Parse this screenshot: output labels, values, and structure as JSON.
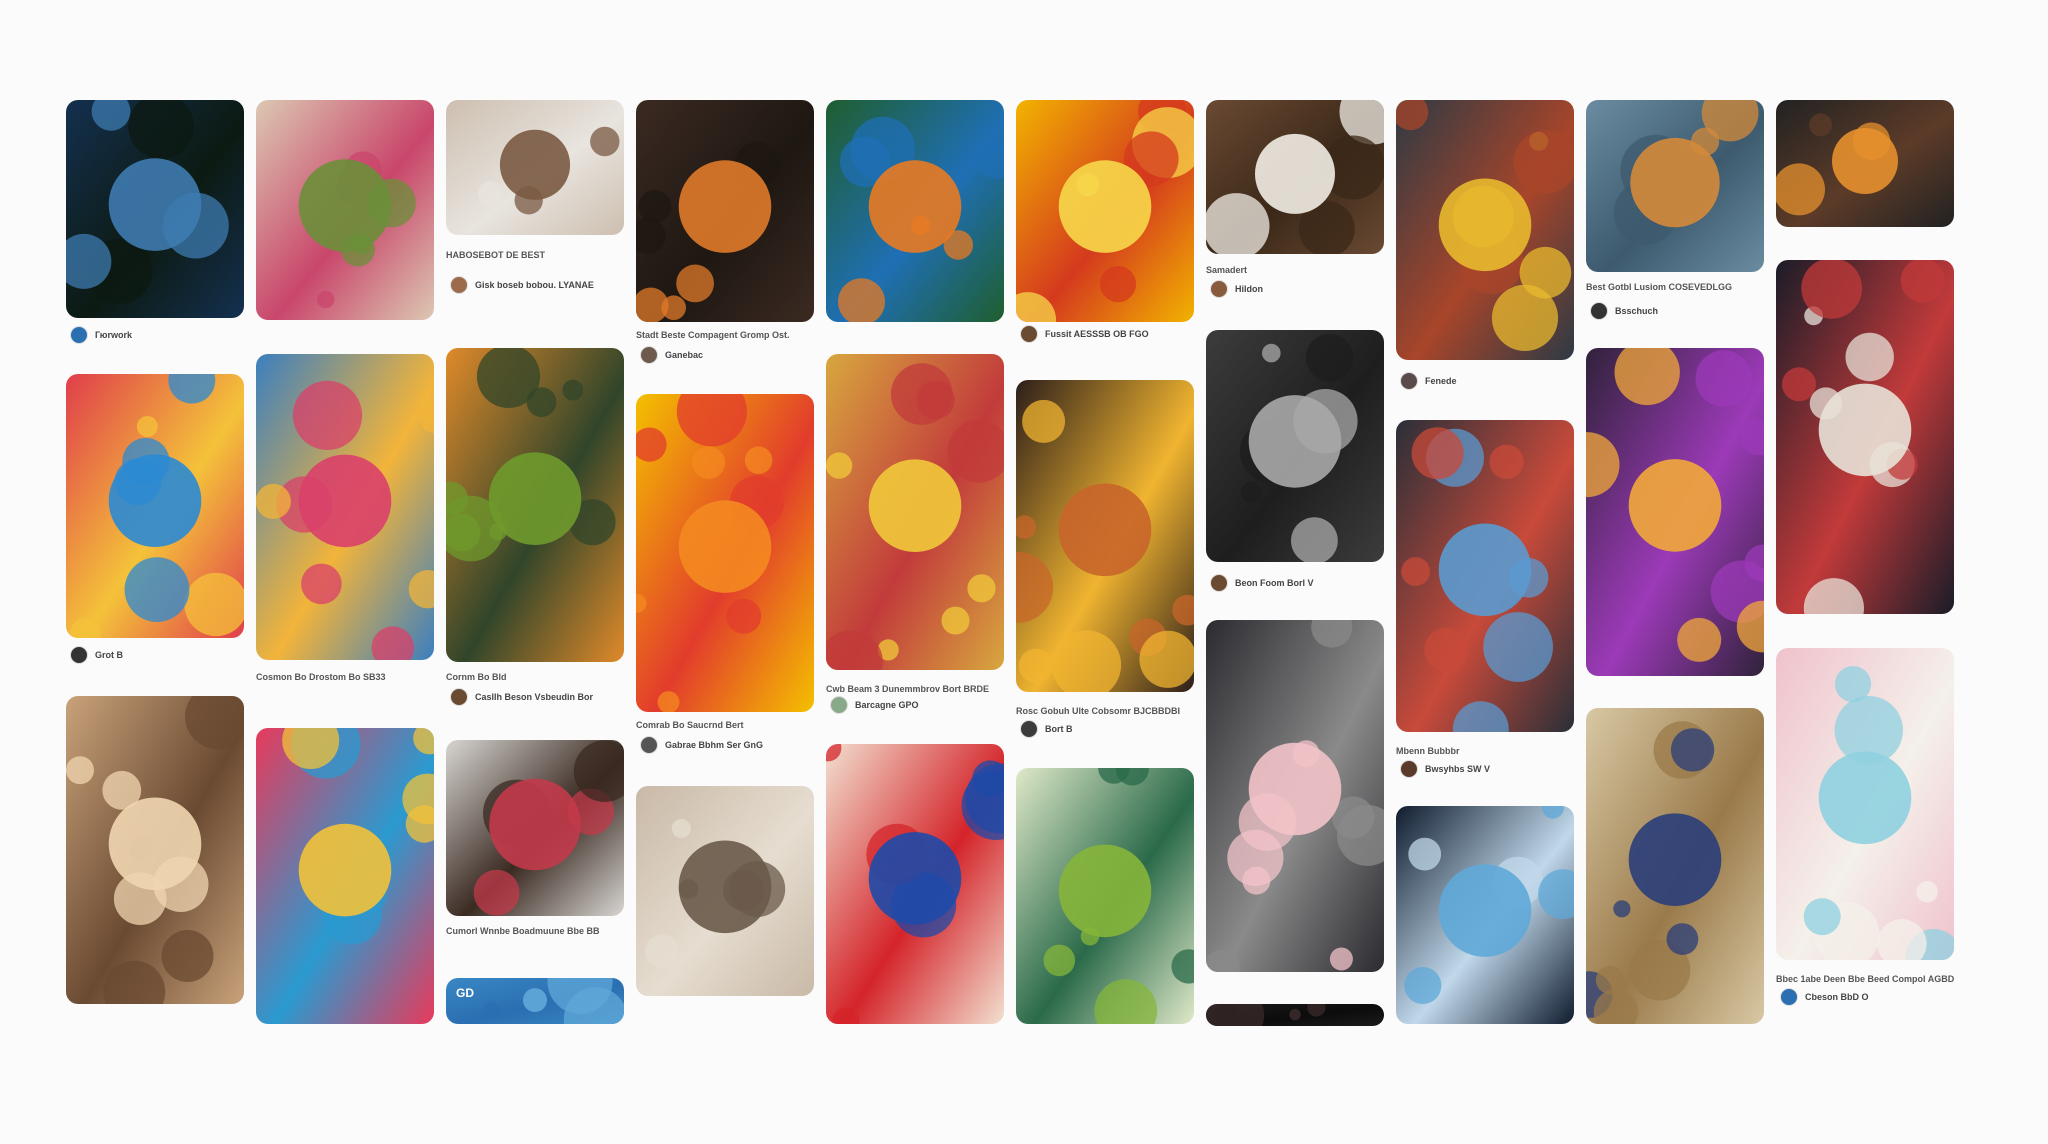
{
  "feed": {
    "pins": [
      {
        "colors": [
          "#14304f",
          "#3e7bb0",
          "#0c1a12"
        ],
        "title": "",
        "user": "Гюrwork",
        "avatar": "#2a6fb1"
      },
      {
        "colors": [
          "#dcc8b2",
          "#6b8f3a",
          "#c9466b"
        ],
        "title": "",
        "user": "",
        "avatar": ""
      },
      {
        "colors": [
          "#cdbfb0",
          "#7a5a43",
          "#e8e4de"
        ],
        "title": "HABOSEBOT DE BEST",
        "user": "Gisk boseb bobou. LYANAE",
        "avatar": "#9c6b4c"
      },
      {
        "colors": [
          "#3b2a22",
          "#e07a2a",
          "#1e1712"
        ],
        "title": "Stadt Beste Compagent Gromp Ost.",
        "user": "Ganebac",
        "avatar": "#6e5a4c"
      },
      {
        "colors": [
          "#1f5e2e",
          "#e87a22",
          "#1f6fb5"
        ],
        "title": "",
        "user": "",
        "avatar": ""
      },
      {
        "colors": [
          "#f2b300",
          "#f7d84a",
          "#d43a1e"
        ],
        "title": "",
        "user": "Fussit AESSSB OB FGO",
        "avatar": "#6b4a32"
      },
      {
        "colors": [
          "#6a4a33",
          "#f2ede6",
          "#3b2818"
        ],
        "title": "Samadert",
        "user": "Hildon",
        "avatar": "#8a5a3c"
      },
      {
        "colors": [
          "#2d3a44",
          "#e8b92e",
          "#a8452a"
        ],
        "title": "",
        "user": "Fenede",
        "avatar": "#5a4a4a"
      },
      {
        "colors": [
          "#6a8ca1",
          "#d48a3a",
          "#3d5a6e"
        ],
        "title": "Best Gotbl Lusiom COSEVEDLGG",
        "user": "Bsschuch",
        "avatar": "#333333"
      },
      {
        "colors": [
          "#222222",
          "#e5902e",
          "#5c3b28"
        ],
        "title": "",
        "user": "",
        "avatar": ""
      },
      {
        "colors": [
          "#e03e4b",
          "#2b8ad4",
          "#f4c23a"
        ],
        "title": "",
        "user": "Grot B",
        "avatar": "#333333"
      },
      {
        "colors": [
          "#3b7fc0",
          "#d9406a",
          "#f2b43a"
        ],
        "title": "Cosmon Bo Drostom Bo SB33",
        "user": "",
        "avatar": ""
      },
      {
        "colors": [
          "#e08a2a",
          "#6f9a2c",
          "#31452a"
        ],
        "title": "Cornm Bo Bld",
        "user": "Casllh Beson Vsbeudin Bor",
        "avatar": "#6b4a32"
      },
      {
        "colors": [
          "#f4c000",
          "#f48a20",
          "#e23c2c"
        ],
        "title": "Comrab Bo Saucrnd Bert",
        "user": "Gabrae Bbhm Ser GnG",
        "avatar": "#555555"
      },
      {
        "colors": [
          "#d8a73e",
          "#f0c93a",
          "#c23b3b"
        ],
        "title": "Cwb Beam 3 Dunemmbrov Bort BRDE",
        "user": "Barcagne GPO",
        "avatar": "#88aa88"
      },
      {
        "colors": [
          "#2c1e1a",
          "#c8652a",
          "#f0b430"
        ],
        "title": "Rosc Gobuh Ulte Cobsomr BJCBBDBI",
        "user": "Bort B",
        "avatar": "#3b3b3b"
      },
      {
        "colors": [
          "#3c3c3c",
          "#a9a9a9",
          "#1e1e1e"
        ],
        "title": "",
        "user": "Beon Foom Borl V",
        "avatar": "#6b4a32"
      },
      {
        "colors": [
          "#2a2f38",
          "#5a9ad0",
          "#c84a3a"
        ],
        "title": "Mbenn Bubbbr",
        "user": "Bwsyhbs SW V",
        "avatar": "#5a3a2a"
      },
      {
        "colors": [
          "#30223a",
          "#f2a83a",
          "#9c3ab8"
        ],
        "title": "",
        "user": "",
        "avatar": ""
      },
      {
        "colors": [
          "#1a1c28",
          "#e8e2d8",
          "#c23a3a"
        ],
        "title": "",
        "user": "",
        "avatar": ""
      },
      {
        "colors": [
          "#c9a27a",
          "#f0d6b0",
          "#6a4a32"
        ],
        "title": "",
        "user": "",
        "avatar": ""
      },
      {
        "colors": [
          "#e83a5a",
          "#f2c23a",
          "#2a9ad0"
        ],
        "title": "",
        "user": "",
        "avatar": ""
      },
      {
        "colors": [
          "#d8d6d2",
          "#c23a4a",
          "#3a2a22"
        ],
        "title": "Cumorl Wnnbe Boadmuune Bbe BB",
        "user": "",
        "avatar": ""
      },
      {
        "colors": [
          "#c9b9a7",
          "#6a5a4a",
          "#e6ddd0"
        ],
        "title": "",
        "user": "",
        "avatar": ""
      },
      {
        "colors": [
          "#f2e0d0",
          "#1e4aa8",
          "#d4242a"
        ],
        "title": "",
        "user": "",
        "avatar": ""
      },
      {
        "colors": [
          "#dfe9c8",
          "#86b53a",
          "#2a6a4a"
        ],
        "title": "",
        "user": "",
        "avatar": ""
      },
      {
        "colors": [
          "#2b2b30",
          "#f2c3c8",
          "#8a8a8a"
        ],
        "title": "",
        "user": "",
        "avatar": ""
      },
      {
        "colors": [
          "#0f1c2e",
          "#5fa8d8",
          "#c0d8ea"
        ],
        "title": "",
        "user": "",
        "avatar": ""
      },
      {
        "colors": [
          "#d8c8a4",
          "#2a3e7a",
          "#9a7a4a"
        ],
        "title": "",
        "user": "",
        "avatar": ""
      },
      {
        "colors": [
          "#f0c2cc",
          "#8fd0e0",
          "#f4f0ea"
        ],
        "title": "Bbec 1abe Deen Bbe Beed Compol AGBDb",
        "user": "Cbeson BbD O",
        "avatar": "#2a6fb1"
      },
      {
        "colors": [
          "#3a87c5",
          "#5fa8d8",
          "#2a6fb1"
        ],
        "title": "GD",
        "user": "",
        "avatar": ""
      },
      {
        "colors": [
          "#1c1a1a",
          "#3a2a2a",
          "#0c0c0c"
        ],
        "title": "",
        "user": "",
        "avatar": ""
      }
    ]
  }
}
